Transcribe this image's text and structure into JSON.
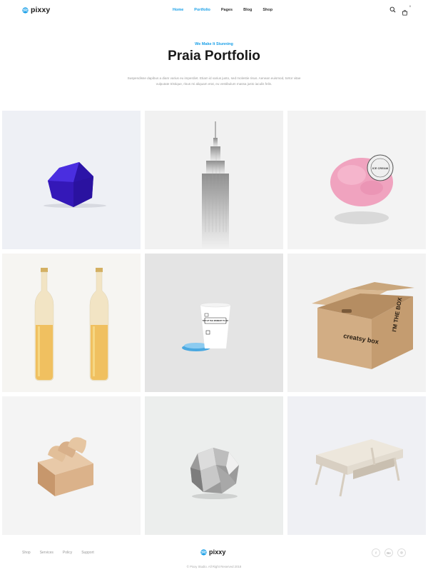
{
  "header": {
    "logo_text": "pixxy",
    "nav": [
      {
        "label": "Home",
        "active": true
      },
      {
        "label": "Portfolio",
        "active": true
      },
      {
        "label": "Pages",
        "active": false
      },
      {
        "label": "Blog",
        "active": false
      },
      {
        "label": "Shop",
        "active": false
      }
    ],
    "cart_count": "0",
    "icons": [
      "search-icon",
      "shopping-bag-icon"
    ]
  },
  "hero": {
    "eyebrow": "We Make It Stunning",
    "title": "Praia Portfolio",
    "description": "Suspendisse dapibus a diam varius eu imperdiet. Etiam id varius justo, sed molestie risus. Aenean euismod, tortor vitae vulputate tristique, risus mi aliquam erat, eu vestibulum massa justo iaculis felis."
  },
  "portfolio": {
    "items": [
      {
        "name": "blue-polyhedron",
        "bg": "#eef0f5"
      },
      {
        "name": "skyscraper",
        "bg": "#f1f1f1"
      },
      {
        "name": "pink-ice-cream",
        "bg": "#f3f3f3",
        "stamp_text": "ICE CREAM"
      },
      {
        "name": "glass-bottles",
        "bg": "#f6f5f2"
      },
      {
        "name": "paper-cup",
        "bg": "#e4e4e4",
        "cup_text": "TOP UP THE MOMENT TO 9K!"
      },
      {
        "name": "cardboard-box",
        "bg": "#f2f2f2",
        "box_brand": "creatsy box",
        "box_slogan": "I'M THE BOX"
      },
      {
        "name": "wooden-blocks",
        "bg": "#f4f4f4"
      },
      {
        "name": "crumpled-paper",
        "bg": "#eceeed"
      },
      {
        "name": "coffee-table",
        "bg": "#eff0f4"
      }
    ]
  },
  "footer": {
    "links": [
      "Shop",
      "Services",
      "Policy",
      "Support"
    ],
    "logo_text": "pixxy",
    "socials": [
      "f",
      "Be",
      "◎"
    ],
    "social_names": [
      "facebook-icon",
      "behance-icon",
      "dribbble-icon"
    ],
    "copyright": "© Pixxy Studio. All Right Reserved 2018"
  },
  "colors": {
    "accent": "#1aa0e8",
    "text": "#1a1a1a",
    "muted": "#999999"
  }
}
